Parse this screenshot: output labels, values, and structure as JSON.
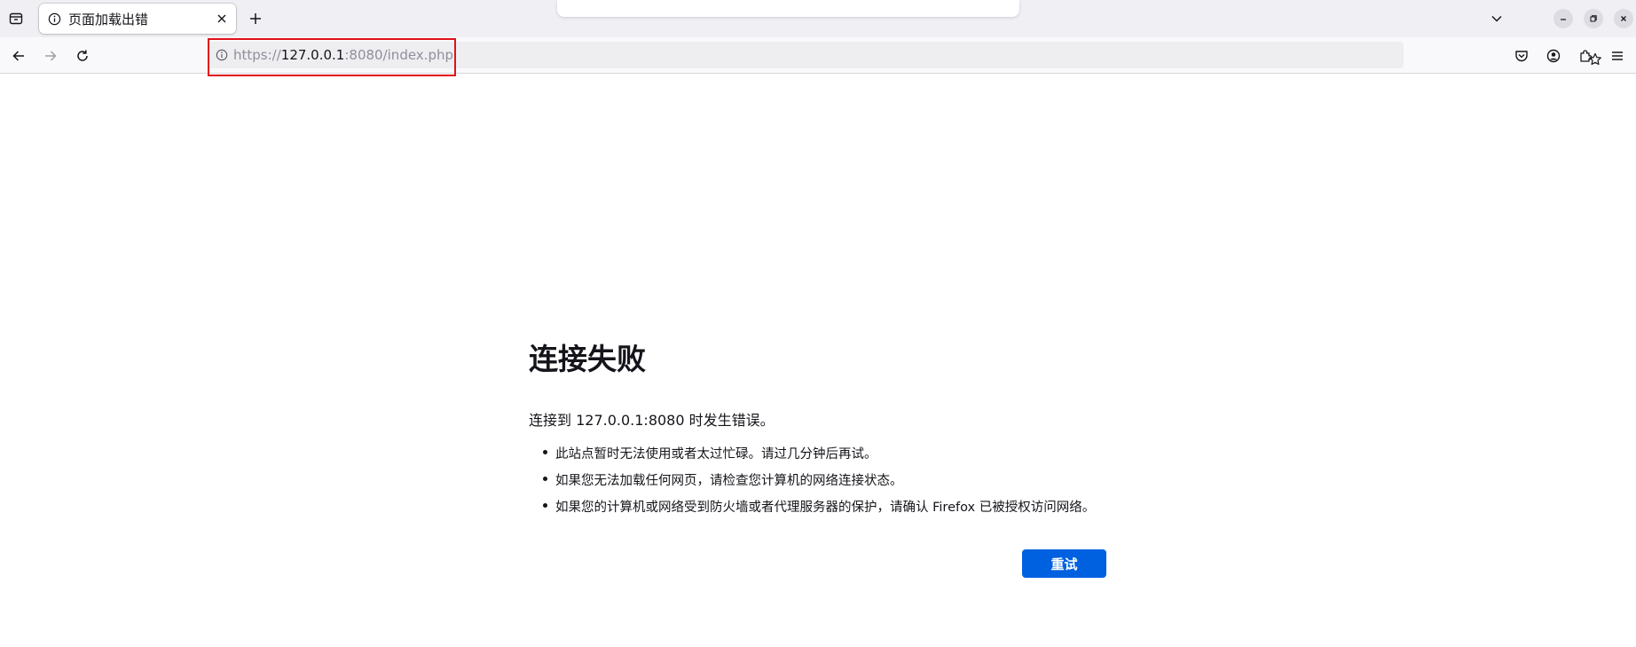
{
  "tab": {
    "title": "页面加载出错"
  },
  "urlbar": {
    "scheme": "https://",
    "host": "127.0.0.1",
    "rest": ":8080/index.php"
  },
  "error_page": {
    "title": "连接失败",
    "description": "连接到 127.0.0.1:8080 时发生错误。",
    "suggestions": [
      "此站点暂时无法使用或者太过忙碌。请过几分钟后再试。",
      "如果您无法加载任何网页，请检查您计算机的网络连接状态。",
      "如果您的计算机或网络受到防火墙或者代理服务器的保护，请确认 Firefox 已被授权访问网络。"
    ],
    "retry_label": "重试"
  },
  "colors": {
    "accent": "#0061e0",
    "highlight_box": "#e0111b"
  },
  "icons": [
    "tab-list-icon",
    "info-icon",
    "close-icon",
    "plus-icon",
    "chevron-down-icon",
    "minimize-icon",
    "restore-icon",
    "window-close-icon",
    "back-arrow-icon",
    "forward-arrow-icon",
    "reload-icon",
    "star-icon",
    "pocket-icon",
    "account-icon",
    "extensions-icon",
    "menu-icon"
  ]
}
